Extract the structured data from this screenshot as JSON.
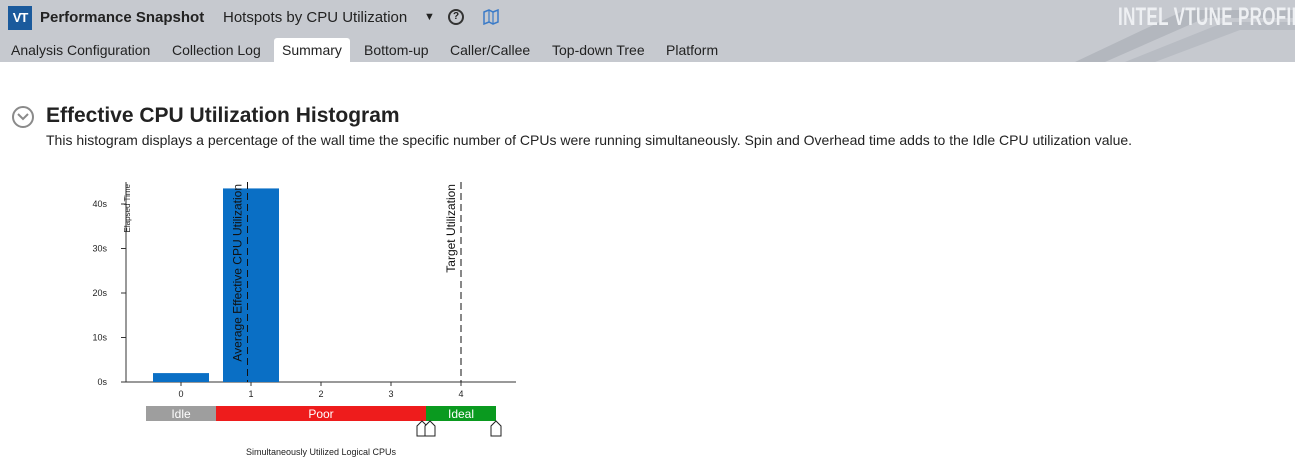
{
  "app": {
    "logo_text": "VT",
    "title": "Performance Snapshot",
    "analysis_type": "Hotspots by CPU Utilization",
    "brand": "INTEL VTUNE PROFILER"
  },
  "tabs": [
    {
      "label": "Analysis Configuration",
      "active": false
    },
    {
      "label": "Collection Log",
      "active": false
    },
    {
      "label": "Summary",
      "active": true
    },
    {
      "label": "Bottom-up",
      "active": false
    },
    {
      "label": "Caller/Callee",
      "active": false
    },
    {
      "label": "Top-down Tree",
      "active": false
    },
    {
      "label": "Platform",
      "active": false
    }
  ],
  "section": {
    "title": "Effective CPU Utilization Histogram",
    "description": "This histogram displays a percentage of the wall time the specific number of CPUs were running simultaneously. Spin and Overhead time adds to the Idle CPU utilization value."
  },
  "chart_data": {
    "type": "bar",
    "categories": [
      "0",
      "1",
      "2",
      "3",
      "4"
    ],
    "values": [
      2,
      43.5,
      0,
      0,
      0
    ],
    "ylabel": "Elapsed Time",
    "xlabel": "Simultaneously Utilized Logical CPUs",
    "ylim": [
      0,
      45
    ],
    "yticks": [
      "0s",
      "10s",
      "20s",
      "30s",
      "40s"
    ],
    "bar_color": "#0a6fc5",
    "markers": [
      {
        "label": "Average Effective CPU Utilization",
        "x": 0.95
      },
      {
        "label": "Target Utilization",
        "x": 4
      }
    ],
    "zones": [
      {
        "label": "Idle",
        "from": -0.5,
        "to": 0.5,
        "color": "#9e9e9e"
      },
      {
        "label": "Poor",
        "from": 0.5,
        "to": 3.5,
        "color": "#ee1c1c"
      },
      {
        "label": "Ideal",
        "from": 3.5,
        "to": 4.5,
        "color": "#0a9a1f"
      }
    ],
    "sliders": [
      3.5,
      4.5
    ],
    "grid": false
  }
}
